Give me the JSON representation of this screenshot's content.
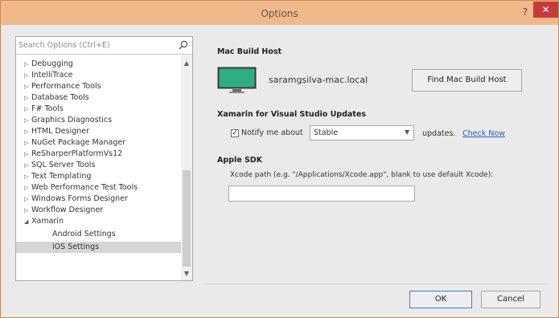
{
  "window": {
    "title": "Options",
    "help_glyph": "?",
    "close_glyph": "✕"
  },
  "colors": {
    "titlebar": "#f1b98b",
    "close": "#c73a3a",
    "link": "#2b5fbf",
    "monitor": "#2fae84"
  },
  "sidebar": {
    "search_placeholder": "Search Options (Ctrl+E)",
    "items": [
      {
        "label": "Debugging",
        "arrow": "▷"
      },
      {
        "label": "IntelliTrace",
        "arrow": "▷"
      },
      {
        "label": "Performance Tools",
        "arrow": "▷"
      },
      {
        "label": "Database Tools",
        "arrow": "▷"
      },
      {
        "label": "F# Tools",
        "arrow": "▷"
      },
      {
        "label": "Graphics Diagnostics",
        "arrow": "▷"
      },
      {
        "label": "HTML Designer",
        "arrow": "▷"
      },
      {
        "label": "NuGet Package Manager",
        "arrow": "▷"
      },
      {
        "label": "ReSharperPlatformVs12",
        "arrow": "▷"
      },
      {
        "label": "SQL Server Tools",
        "arrow": "▷"
      },
      {
        "label": "Text Templating",
        "arrow": "▷"
      },
      {
        "label": "Web Performance Test Tools",
        "arrow": "▷"
      },
      {
        "label": "Windows Forms Designer",
        "arrow": "▷"
      },
      {
        "label": "Workflow Designer",
        "arrow": "▷"
      },
      {
        "label": "Xamarin",
        "arrow": "◢"
      },
      {
        "label": "Android Settings",
        "arrow": ""
      },
      {
        "label": "iOS Settings",
        "arrow": ""
      }
    ],
    "selected": "iOS Settings"
  },
  "mac_build_host": {
    "section_title": "Mac Build Host",
    "host_name": "saramgsilva-mac.local",
    "find_button": "Find Mac Build Host"
  },
  "updates": {
    "section_title": "Xamarin for Visual Studio Updates",
    "notify_label": "Notify me about",
    "notify_checked": true,
    "channel": "Stable",
    "suffix": "updates.",
    "check_now": "Check Now"
  },
  "apple_sdk": {
    "section_title": "Apple SDK",
    "xcode_label": "Xcode path (e.g. \"/Applications/Xcode.app\", blank to use default Xcode):",
    "xcode_value": ""
  },
  "footer": {
    "ok": "OK",
    "cancel": "Cancel"
  }
}
